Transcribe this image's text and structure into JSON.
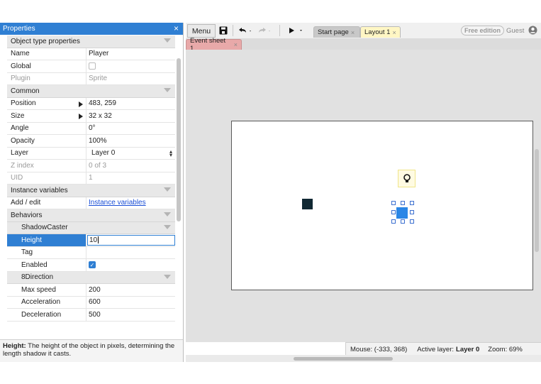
{
  "properties_panel": {
    "title": "Properties",
    "rows": [
      {
        "kind": "section",
        "label": "Object type properties"
      },
      {
        "kind": "prop",
        "label": "Name",
        "value": "Player"
      },
      {
        "kind": "check",
        "label": "Global",
        "checked": false
      },
      {
        "kind": "prop",
        "label": "Plugin",
        "value": "Sprite",
        "disabled": true
      },
      {
        "kind": "section",
        "label": "Common"
      },
      {
        "kind": "expand",
        "label": "Position",
        "value": "483, 259"
      },
      {
        "kind": "expand",
        "label": "Size",
        "value": "32 x 32"
      },
      {
        "kind": "prop",
        "label": "Angle",
        "value": "0°"
      },
      {
        "kind": "prop",
        "label": "Opacity",
        "value": "100%"
      },
      {
        "kind": "select",
        "label": "Layer",
        "value": "Layer 0"
      },
      {
        "kind": "prop",
        "label": "Z index",
        "value": "0 of 3",
        "disabled": true
      },
      {
        "kind": "prop",
        "label": "UID",
        "value": "1",
        "disabled": true
      },
      {
        "kind": "section",
        "label": "Instance variables"
      },
      {
        "kind": "link",
        "label": "Add / edit",
        "value": "Instance variables"
      },
      {
        "kind": "section",
        "label": "Behaviors"
      },
      {
        "kind": "subsection",
        "label": "ShadowCaster"
      },
      {
        "kind": "edit",
        "label": "Height",
        "value": "10"
      },
      {
        "kind": "sub",
        "label": "Tag",
        "value": ""
      },
      {
        "kind": "subcheck",
        "label": "Enabled",
        "checked": true
      },
      {
        "kind": "subsection",
        "label": "8Direction"
      },
      {
        "kind": "sub",
        "label": "Max speed",
        "value": "200"
      },
      {
        "kind": "sub",
        "label": "Acceleration",
        "value": "600"
      },
      {
        "kind": "sub",
        "label": "Deceleration",
        "value": "500"
      }
    ],
    "help": {
      "term": "Height:",
      "text": " The height of the object in pixels, determining the length shadow it casts."
    }
  },
  "toolbar": {
    "menu_label": "Menu",
    "tabs": [
      {
        "label": "Start page",
        "active": false
      },
      {
        "label": "Layout 1",
        "active": true
      }
    ],
    "edition_badge": "Free edition",
    "user_label": "Guest"
  },
  "subtabs": {
    "event_sheet": "Event sheet 1"
  },
  "status_bar": {
    "mouse": "Mouse: (-333, 368)",
    "active_layer_label": "Active layer:",
    "active_layer_value": "Layer 0",
    "zoom": "Zoom: 69%"
  },
  "colors": {
    "accent": "#2f7fd3",
    "player_sprite": "#2a86e6",
    "dark_sprite": "#112833",
    "event_tab": "#e8a9a9",
    "layout_tab": "#fff6c4"
  },
  "close_glyph": "×"
}
